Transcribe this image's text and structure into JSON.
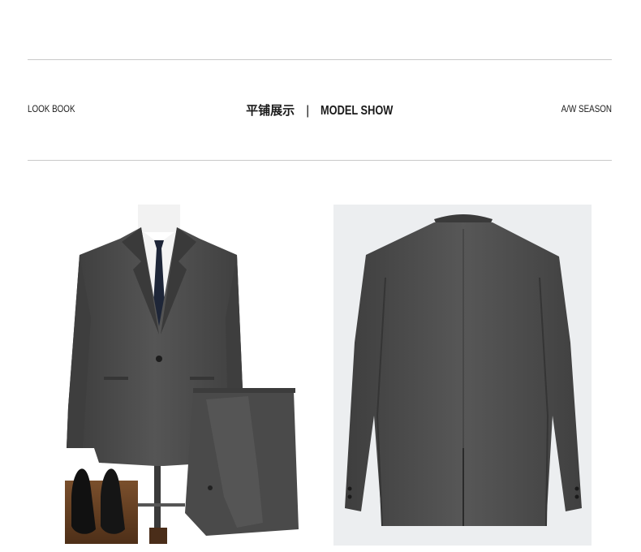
{
  "header": {
    "left_label": "LOOK BOOK",
    "center_cn": "平铺展示",
    "center_sep": "|",
    "center_en": "MODEL SHOW",
    "right_label": "A/W SEASON"
  },
  "colors": {
    "suit": "#4a4a4a",
    "rule": "#c9c9c9",
    "back_bg": "#eceef0"
  }
}
